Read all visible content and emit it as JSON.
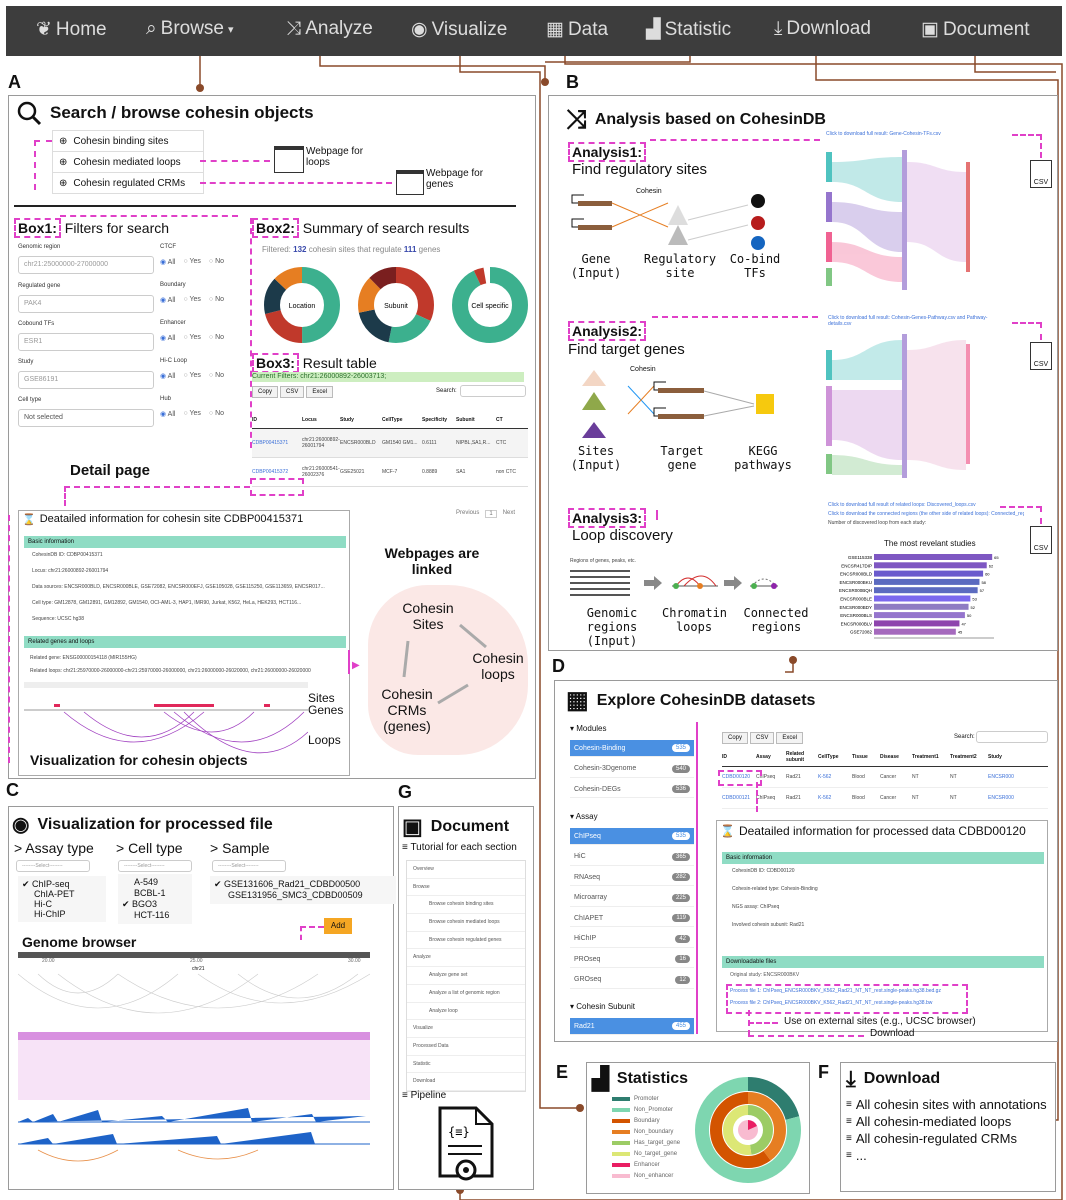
{
  "nav": {
    "items": [
      {
        "label": "Home",
        "icon": "leaf-icon"
      },
      {
        "label": "Browse",
        "icon": "search-icon"
      },
      {
        "label": "Analyze",
        "icon": "shuffle-icon"
      },
      {
        "label": "Visualize",
        "icon": "eye-icon"
      },
      {
        "label": "Data",
        "icon": "grid-icon"
      },
      {
        "label": "Statistic",
        "icon": "bar-chart-icon"
      },
      {
        "label": "Download",
        "icon": "download-icon"
      },
      {
        "label": "Document",
        "icon": "briefcase-icon"
      }
    ]
  },
  "panel_a": {
    "letter": "A",
    "title": "Search / browse cohesin objects",
    "menu": [
      "Cohesin binding sites",
      "Cohesin mediated loops",
      "Cohesin regulated CRMs"
    ],
    "webpage_loops": "Webpage for loops",
    "webpage_genes": "Webpage for genes",
    "box1_label": "Box1:",
    "box1_title": "Filters for search",
    "filters": {
      "genomic_region": {
        "label": "Genomic region",
        "placeholder": "chr21:25000000-27000000"
      },
      "regulated_gene": {
        "label": "Regulated gene",
        "placeholder": "PAK4"
      },
      "cobound_tfs": {
        "label": "Cobound TFs",
        "placeholder": "ESR1"
      },
      "study": {
        "label": "Study",
        "placeholder": "GSE86191"
      },
      "cell_type": {
        "label": "Cell type",
        "value": "Not selected"
      }
    },
    "radios": [
      {
        "label": "CTCF"
      },
      {
        "label": "Boundary"
      },
      {
        "label": "Enhancer"
      },
      {
        "label": "Hi-C Loop"
      },
      {
        "label": "Hub"
      }
    ],
    "radio_opts": [
      "All",
      "Yes",
      "No"
    ],
    "box2_label": "Box2:",
    "box2_title": "Summary of search results",
    "summary_prefix": "Filtered:",
    "summary_n_sites": "132",
    "summary_mid": "cohesin sites that regulate",
    "summary_n_genes": "111",
    "summary_suffix": "genes",
    "donuts": [
      "Location",
      "Subunit",
      "Cell specific"
    ],
    "box3_label": "Box3:",
    "box3_title": "Result table",
    "current_filters": "Current Filters: chr21:26000892-26003713;",
    "table_buttons": [
      "Copy",
      "CSV",
      "Excel"
    ],
    "search_label": "Search:",
    "table_headers": [
      "ID",
      "Locus",
      "Study",
      "CellType",
      "Specificity",
      "Subunit",
      "CT"
    ],
    "table_rows": [
      [
        "CDBP00415371",
        "chr21:26000892-26001794",
        "ENCSR000BLD",
        "GM1540 GM1...",
        "0.6111",
        "NIPBL,SA1,R...",
        "CTC"
      ],
      [
        "CDBP00415372",
        "chr21:26000541-26002376",
        "GSE25021",
        "MCF-7",
        "0.8889",
        "SA1",
        "non CTC"
      ]
    ],
    "pager": [
      "Previous",
      "1",
      "Next"
    ],
    "detail_page": "Detail page",
    "detail_title": "Deatailed information for cohesin site CDBP00415371",
    "basic_info": "Basic information",
    "detail_fields": [
      "CohesinDB ID: CDBP00415371",
      "Locus: chr21:26000892-26001794",
      "Data sources: ENCSR000BLD, ENCSR000BLE, GSE72082, ENCSR000EFJ, GSE105028, GSE115250, GSE113659, ENCSR017...",
      "Cell type: GM12878, GM12891, GM12892, GM1540, OCI-AML-3, HAP1, IMR90, Jurkat, K562, HeLa, HEK293, HCT116...",
      "Sequence: UCSC hg38"
    ],
    "related_title": "Related genes and loops",
    "related_gene": "Related gene: ENSG00000154118 (MIR155HG)",
    "related_loops": "Related loops: chr21:25970000-26000000-chr21:25970000-26000000, chr21:26000000-26020000, chr21:26000000-26020000",
    "track_labels": [
      "Sites",
      "Genes",
      "Loops"
    ],
    "vis_caption": "Visualization for cohesin objects",
    "linked_title": "Webpages are linked",
    "linked_nodes": [
      "Cohesin Sites",
      "Cohesin loops",
      "Cohesin CRMs (genes)"
    ]
  },
  "panel_b": {
    "letter": "B",
    "title": "Analysis based on CohesinDB",
    "a1_label": "Analysis1:",
    "a1_title": "Find regulatory sites",
    "a1_cohesin": "Cohesin",
    "a1_steps": [
      "Gene (Input)",
      "Regulatory site",
      "Co-bind TFs"
    ],
    "a1_link": "Click to download full result: Gene-Cohesin-TFs.csv",
    "a2_label": "Analysis2:",
    "a2_title": "Find target genes",
    "a2_cohesin": "Cohesin",
    "a2_steps": [
      "Sites (Input)",
      "Target gene",
      "KEGG pathways"
    ],
    "a2_link": "Click to download full result: Cohesin-Genes-Pathway.csv and Pathway-details.csv",
    "a3_label": "Analysis3:",
    "a3_title": "Loop discovery",
    "a3_input_label": "Regions of genes, peaks, etc.",
    "a3_steps": [
      "Genomic regions (Input)",
      "Chromatin loops",
      "Connected regions"
    ],
    "a3_links": [
      "Click to download full result of related loops: Discovered_loops.csv",
      "Click to download the connected regions (the other side of related loops): Connected_regions.csv",
      "Number of discovered loop from each study:"
    ],
    "a3_chart_title": "The most revelant studies",
    "csv": "CSV"
  },
  "panel_c": {
    "letter": "C",
    "title": "Visualization for processed file",
    "cols": [
      "> Assay type",
      "> Cell type",
      "> Sample"
    ],
    "select": "--------Select--------",
    "assay_types": [
      "ChIP-seq",
      "ChIA-PET",
      "Hi-C",
      "Hi-ChIP"
    ],
    "cell_types": [
      "A-549",
      "BCBL-1",
      "BGO3",
      "HCT-116"
    ],
    "samples": [
      "GSE131606_Rad21_CDBD00500",
      "GSE131956_SMC3_CDBD00509"
    ],
    "add": "Add",
    "genome_browser": "Genome browser",
    "chrom": "chr21",
    "ticks": [
      "20.00",
      "25.00",
      "30.00"
    ]
  },
  "panel_d": {
    "letter": "D",
    "title": "Explore CohesinDB datasets",
    "modules_head": "Modules",
    "modules": [
      {
        "label": "Cohesin-Binding",
        "count": "535",
        "sel": true
      },
      {
        "label": "Cohesin-3Dgenome",
        "count": "540",
        "sel": false
      },
      {
        "label": "Cohesin-DEGs",
        "count": "536",
        "sel": false
      }
    ],
    "assay_head": "Assay",
    "assays": [
      {
        "label": "ChIPseq",
        "count": "535",
        "sel": true
      },
      {
        "label": "HiC",
        "count": "365",
        "sel": false
      },
      {
        "label": "RNAseq",
        "count": "282",
        "sel": false
      },
      {
        "label": "Microarray",
        "count": "225",
        "sel": false
      },
      {
        "label": "ChIAPET",
        "count": "119",
        "sel": false
      },
      {
        "label": "HiChIP",
        "count": "42",
        "sel": false
      },
      {
        "label": "PROseq",
        "count": "16",
        "sel": false
      },
      {
        "label": "GROseq",
        "count": "12",
        "sel": false
      }
    ],
    "subunit_head": "Cohesin Subunit",
    "subunits": [
      {
        "label": "Rad21",
        "count": "455",
        "sel": true
      }
    ],
    "table_buttons": [
      "Copy",
      "CSV",
      "Excel"
    ],
    "search_label": "Search:",
    "table_headers": [
      "ID",
      "Assay",
      "Related subunit",
      "CellType",
      "Tissue",
      "Disease",
      "Treatment1",
      "Treatment2",
      "Study"
    ],
    "table_rows": [
      [
        "CDBD00120",
        "ChIPseq",
        "Rad21",
        "K-562",
        "Blood",
        "Cancer",
        "NT",
        "NT",
        "ENCSR000"
      ],
      [
        "CDBD00121",
        "ChIPseq",
        "Rad21",
        "K-562",
        "Blood",
        "Cancer",
        "NT",
        "NT",
        "ENCSR000"
      ]
    ],
    "detail_title": "Deatailed information for processed data CDBD00120",
    "basic_info": "Basic information",
    "detail_fields": [
      "CohesinDB ID: CDBD00120",
      "Cohesin-related type: Cohesin-Binding",
      "NGS assay: ChIPseq",
      "Involved cohesin subunit: Rad21"
    ],
    "downloadable": "Downloadable files",
    "original_study": "Original study: ENCSR000BKV",
    "process_files": [
      "Process file 1: ChIPseq_ENCSR000BKV_K562_Rad21_NT_NT_rest.single-peaks.hg38.bed.gz",
      "Process file 2: ChIPseq_ENCSR000BKV_K562_Rad21_NT_NT_rest.single-peaks.hg38.bw"
    ],
    "ext_sites": "Use on external sites (e.g., UCSC browser)",
    "download": "Download"
  },
  "panel_e": {
    "letter": "E",
    "title": "Statistics",
    "legend": [
      "Promoter",
      "Non_Promoter",
      "Boundary",
      "Non_boundary",
      "Has_target_gene",
      "No_target_gene",
      "Enhancer",
      "Non_enhancer"
    ]
  },
  "panel_f": {
    "letter": "F",
    "title": "Download",
    "items": [
      "All cohesin sites with annotations",
      "All cohesin-mediated loops",
      "All cohesin-regulated CRMs",
      "..."
    ]
  },
  "panel_g": {
    "letter": "G",
    "title": "Document",
    "tutorial": "Tutorial for each section",
    "tree": [
      "Overview",
      "Browse",
      "Browse cohesin binding sites",
      "Browse cohesin mediated loops",
      "Browse cohesin regulated genes",
      "Analyze",
      "Analyze gene set",
      "Analyze a list of genomic region",
      "Analyze loop",
      "Visualize",
      "Processed Data",
      "Statistic",
      "Download"
    ],
    "pipeline": "Pipeline"
  },
  "chart_data": {
    "type": "bar",
    "title": "The most revelant studies",
    "categories": [
      "GSE115338",
      "ENCSR417DIP",
      "ENCSR000BLD",
      "ENCSR000BKU",
      "ENCSR000BQH",
      "ENCSR000BLE",
      "ENCSR000BDY",
      "ENCSR000BLS",
      "ENCSR000BLV",
      "GSE72082"
    ],
    "values": [
      65,
      62,
      60,
      58,
      57,
      53,
      52,
      50,
      47,
      45
    ],
    "xlim": [
      0,
      60
    ]
  }
}
